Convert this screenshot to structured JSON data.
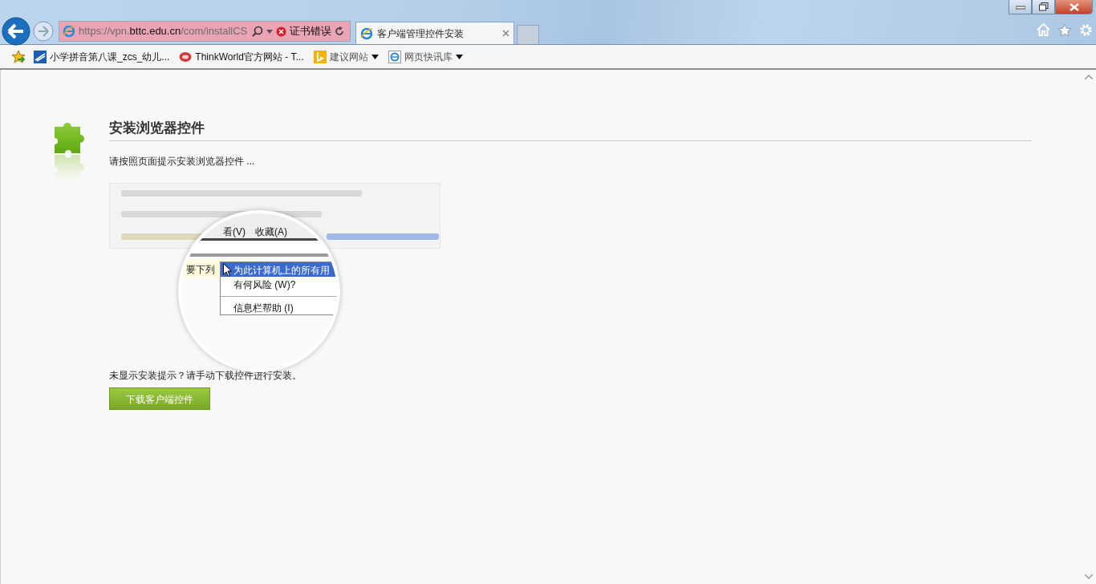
{
  "address_bar": {
    "url": [
      {
        "text": "https://vpn.",
        "highlight": false
      },
      {
        "text": "bttc.edu.cn",
        "highlight": true
      },
      {
        "text": "/com/installCS",
        "highlight": false
      }
    ],
    "certificate_error": "证书错误"
  },
  "tabs": [
    {
      "label": "客户端管理控件安装",
      "selected": true
    }
  ],
  "favorites": [
    {
      "label": "小学拼音第八课_zcs_幼儿...",
      "kind": "link"
    },
    {
      "label": "ThinkWorld官方网站 - T...",
      "kind": "link"
    },
    {
      "label": "建议网站",
      "kind": "dropdown"
    },
    {
      "label": "网页快讯库",
      "kind": "dropdown"
    }
  ],
  "page": {
    "heading": "安装浏览器控件",
    "intro": "请按照页面提示安装浏览器控件 ...",
    "illustration": {
      "menubar": [
        "看(V)",
        "收藏(A)"
      ],
      "infobar_text": "要下列",
      "context_menu": [
        {
          "label": "为此计算机上的所有用",
          "selected": true
        },
        {
          "label": "有何风险 (W)?",
          "selected": false
        },
        {
          "label": "信息栏帮助 (I)",
          "selected": false
        }
      ]
    },
    "note": "未显示安装提示？请手动下载控件进行安装。",
    "download_button": "下载客户端控件"
  }
}
